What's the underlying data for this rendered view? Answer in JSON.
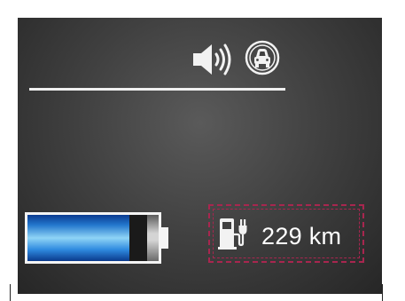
{
  "display": {
    "icons": {
      "volume": "speaker-volume-icon",
      "vehicle": "car-front-icon",
      "charging": "ev-charging-station-icon"
    },
    "battery": {
      "charge_level": 0.78
    },
    "range": {
      "text": "229 km"
    }
  },
  "colors": {
    "screen_background": "#404040",
    "highlight_border": "#a8264f",
    "battery_fill": "#2f8be0",
    "text": "#ffffff"
  }
}
